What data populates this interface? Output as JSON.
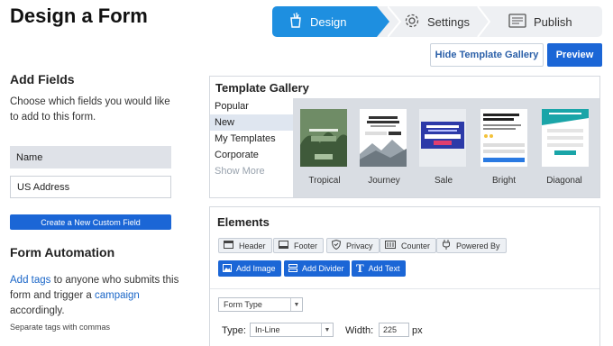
{
  "page_title": "Design a Form",
  "steps": [
    {
      "label": "Design",
      "icon": "cup-icon",
      "active": true
    },
    {
      "label": "Settings",
      "icon": "gear-icon",
      "active": false
    },
    {
      "label": "Publish",
      "icon": "publish-icon",
      "active": false
    }
  ],
  "toolbar": {
    "hide_gallery": "Hide Template Gallery",
    "preview": "Preview"
  },
  "add_fields": {
    "heading": "Add Fields",
    "desc": "Choose which fields you would like to add to this form.",
    "fields": [
      "Name",
      "US Address"
    ],
    "custom_button": "Create a New Custom Field"
  },
  "automation": {
    "heading": "Form Automation",
    "link_add_tags": "Add tags",
    "text_1": " to anyone who submits this form and trigger a ",
    "link_campaign": "campaign",
    "text_2": " accordingly.",
    "hint": "Separate tags with commas"
  },
  "gallery": {
    "title": "Template Gallery",
    "categories": [
      "Popular",
      "New",
      "My Templates",
      "Corporate"
    ],
    "selected": "New",
    "show_more": "Show More",
    "templates": [
      "Tropical",
      "Journey",
      "Sale",
      "Bright",
      "Diagonal"
    ]
  },
  "elements": {
    "title": "Elements",
    "chips": [
      {
        "label": "Header",
        "icon": "header-icon"
      },
      {
        "label": "Footer",
        "icon": "footer-icon"
      },
      {
        "label": "Privacy",
        "icon": "shield-icon"
      },
      {
        "label": "Counter",
        "icon": "counter-icon"
      },
      {
        "label": "Powered By",
        "icon": "plug-icon"
      }
    ],
    "actions": [
      {
        "label": "Add Image",
        "icon": "image-icon"
      },
      {
        "label": "Add Divider",
        "icon": "divider-icon"
      },
      {
        "label": "Add Text",
        "icon": "text-icon"
      }
    ],
    "form_type_select": "Form Type",
    "type_label": "Type:",
    "type_value": "In-Line",
    "width_label": "Width:",
    "width_value": "225",
    "width_unit": "px"
  },
  "colors": {
    "accent": "#1b66d6",
    "step_active": "#1e8fe0"
  }
}
